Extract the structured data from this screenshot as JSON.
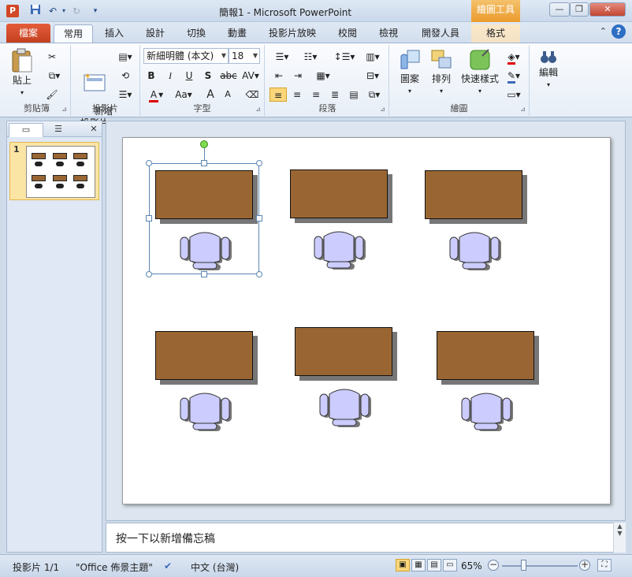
{
  "window": {
    "app_icon": "P",
    "title": "簡報1 - Microsoft PowerPoint",
    "context_tab_group": "繪圖工具",
    "qat": {
      "save_icon": "save-icon",
      "undo_icon": "undo-icon",
      "redo_icon": "redo-icon",
      "customize_icon": "chevron-down-icon"
    }
  },
  "tabs": {
    "file": "檔案",
    "items": [
      "常用",
      "插入",
      "設計",
      "切換",
      "動畫",
      "投影片放映",
      "校閱",
      "檢視",
      "開發人員",
      "格式"
    ],
    "active": "常用"
  },
  "ribbon": {
    "clipboard": {
      "label": "剪貼簿",
      "paste": "貼上"
    },
    "slides": {
      "label": "投影片",
      "new_slide": "新增\n投影片"
    },
    "font": {
      "label": "字型",
      "font_name": "新細明體 (本文)",
      "font_size": "18",
      "bold": "B",
      "italic": "I",
      "underline": "U",
      "shadow": "S",
      "strike": "abc",
      "spacing": "AV",
      "aa": "Aa",
      "grow": "A",
      "shrink": "A"
    },
    "paragraph": {
      "label": "段落"
    },
    "drawing": {
      "label": "繪圖",
      "shapes": "圖案",
      "arrange": "排列",
      "quick_styles": "快速樣式"
    },
    "editing": {
      "label": "",
      "edit": "編輯"
    }
  },
  "left_pane": {
    "slide_number": "1"
  },
  "notes": {
    "placeholder": "按一下以新增備忘稿"
  },
  "status": {
    "slide_info": "投影片 1/1",
    "theme": "\"Office 佈景主題\"",
    "language": "中文 (台灣)",
    "zoom": "65%",
    "zoom_minus": "−",
    "zoom_plus": "+"
  },
  "colors": {
    "desk": "#996633",
    "chair": "#ccccff",
    "accent": "#d24726"
  }
}
